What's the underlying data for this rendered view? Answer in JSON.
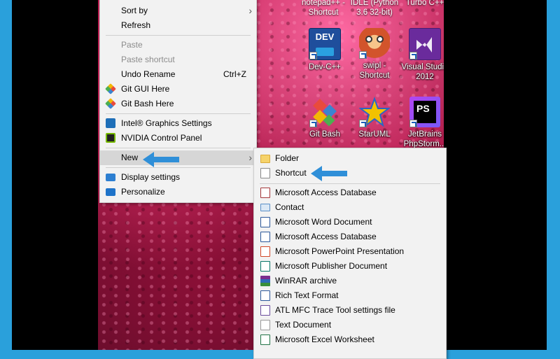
{
  "desktop_icons": [
    {
      "id": "notepadpp",
      "label_lines": [
        "notepad++ -",
        "Shortcut"
      ]
    },
    {
      "id": "idle",
      "label_lines": [
        "IDLE (Python",
        "3.6 32-bit)"
      ]
    },
    {
      "id": "turbo",
      "label_lines": [
        "Turbo C++"
      ]
    },
    {
      "id": "devcpp",
      "label_lines": [
        "Dev-C++"
      ],
      "badge": "DEV"
    },
    {
      "id": "swipl",
      "label_lines": [
        "swipl -",
        "Shortcut"
      ]
    },
    {
      "id": "vs2012",
      "label_lines": [
        "Visual Studio",
        "2012"
      ]
    },
    {
      "id": "gitbash",
      "label_lines": [
        "Git Bash"
      ]
    },
    {
      "id": "staruml",
      "label_lines": [
        "StarUML"
      ]
    },
    {
      "id": "phpstorm",
      "label_lines": [
        "JetBrains",
        "PhpStorm..."
      ],
      "badge": "PS"
    }
  ],
  "context_menu": {
    "items": [
      {
        "label": "Sort by",
        "submenu": true
      },
      {
        "label": "Refresh"
      },
      {
        "label": "Paste",
        "disabled": true
      },
      {
        "label": "Paste shortcut",
        "disabled": true
      },
      {
        "label": "Undo Rename",
        "shortcut": "Ctrl+Z"
      },
      {
        "label": "Git GUI Here",
        "icon": "git-gui-icon"
      },
      {
        "label": "Git Bash Here",
        "icon": "git-bash-icon"
      },
      {
        "label": "Intel® Graphics Settings",
        "icon": "intel-graphics-icon"
      },
      {
        "label": "NVIDIA Control Panel",
        "icon": "nvidia-icon"
      },
      {
        "label": "New",
        "submenu": true,
        "highlighted": true
      },
      {
        "label": "Display settings",
        "icon": "display-icon"
      },
      {
        "label": "Personalize",
        "icon": "personalize-icon"
      }
    ]
  },
  "new_submenu": {
    "items": [
      {
        "label": "Folder",
        "icon": "folder-icon"
      },
      {
        "label": "Shortcut",
        "icon": "shortcut-icon"
      },
      {
        "label": "Microsoft Access Database",
        "icon": "access-icon"
      },
      {
        "label": "Contact",
        "icon": "contact-icon"
      },
      {
        "label": "Microsoft Word Document",
        "icon": "word-icon"
      },
      {
        "label": "Microsoft Access Database",
        "icon": "access-icon"
      },
      {
        "label": "Microsoft PowerPoint Presentation",
        "icon": "powerpoint-icon"
      },
      {
        "label": "Microsoft Publisher Document",
        "icon": "publisher-icon"
      },
      {
        "label": "WinRAR archive",
        "icon": "winrar-icon"
      },
      {
        "label": "Rich Text Format",
        "icon": "rtf-icon"
      },
      {
        "label": "ATL MFC Trace Tool settings file",
        "icon": "atl-icon"
      },
      {
        "label": "Text Document",
        "icon": "text-document-icon"
      },
      {
        "label": "Microsoft Excel Worksheet",
        "icon": "excel-icon"
      }
    ]
  },
  "colors": {
    "annotation_arrow": "#2f8fd8",
    "menu_bg": "#f2f2f2",
    "menu_highlight": "#d6d6d6"
  }
}
